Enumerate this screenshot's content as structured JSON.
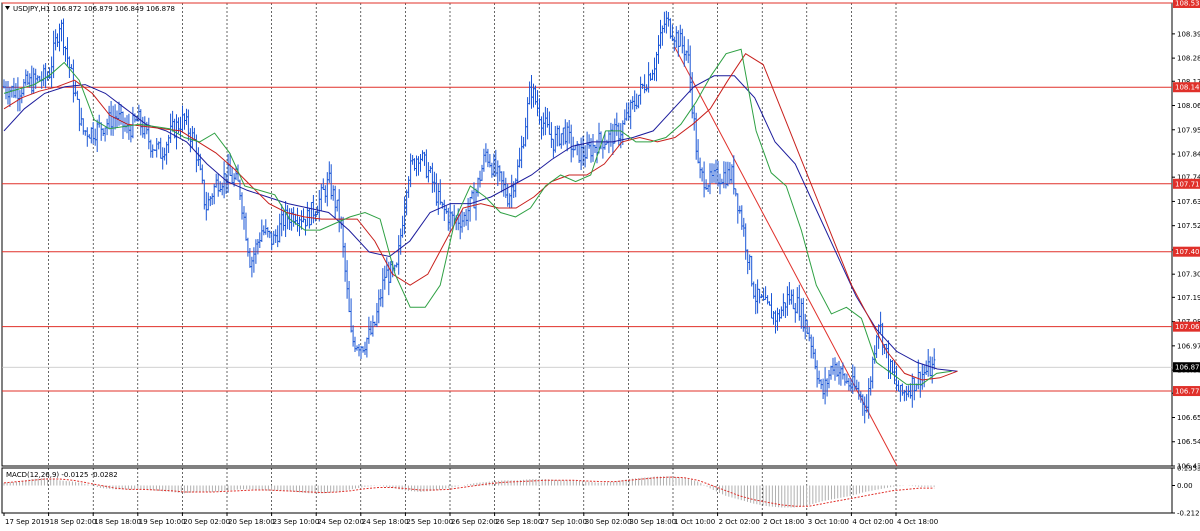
{
  "window": {
    "symbol_header": "USDJPY,H1  106.872 106.879 106.849 106.878",
    "macd_header": "MACD(12,26,9) -0.0125 -0.0282"
  },
  "colors": {
    "candle": "#1a56d6",
    "level": "#e0302a",
    "ma_fast": "#2ea043",
    "ma_mid": "#c8201c",
    "ma_slow": "#1c1c9c",
    "price_tag": "#000000",
    "macd_hist": "#b0b0b0",
    "macd_signal": "#e0302a"
  },
  "chart_data": {
    "type": "candlestick",
    "symbol": "USDJPY",
    "timeframe": "H1",
    "ylim": [
      106.43,
      108.53
    ],
    "y_ticks": [
      "108.390",
      "108.280",
      "108.175",
      "108.065",
      "107.955",
      "107.845",
      "107.740",
      "107.630",
      "107.520",
      "107.410",
      "107.300",
      "107.195",
      "107.085",
      "106.975",
      "106.865",
      "106.760",
      "106.650",
      "106.540",
      "106.430"
    ],
    "x_ticks": [
      "17 Sep 2019",
      "18 Sep 02:00",
      "18 Sep 18:00",
      "19 Sep 10:00",
      "20 Sep 02:00",
      "20 Sep 18:00",
      "23 Sep 10:00",
      "24 Sep 02:00",
      "24 Sep 18:00",
      "25 Sep 10:00",
      "26 Sep 02:00",
      "26 Sep 18:00",
      "27 Sep 10:00",
      "30 Sep 02:00",
      "30 Sep 18:00",
      "1 Oct 10:00",
      "2 Oct 02:00",
      "2 Oct 18:00",
      "3 Oct 10:00",
      "4 Oct 02:00",
      "4 Oct 18:00"
    ],
    "levels": [
      {
        "value": 108.53,
        "label": "108.530"
      },
      {
        "value": 108.148,
        "label": "108.148"
      },
      {
        "value": 107.71,
        "label": "107.710"
      },
      {
        "value": 107.402,
        "label": "107.402"
      },
      {
        "value": 107.062,
        "label": "107.062"
      },
      {
        "value": 106.77,
        "label": "106.770"
      }
    ],
    "current_price": {
      "value": 106.878,
      "label": "106.878"
    },
    "price_path": [
      108.15,
      108.13,
      108.16,
      108.18,
      108.2,
      108.45,
      108.2,
      107.95,
      107.95,
      107.98,
      108.02,
      107.95,
      108.0,
      107.9,
      107.85,
      107.95,
      108.0,
      107.9,
      107.6,
      107.72,
      107.75,
      107.7,
      107.35,
      107.5,
      107.45,
      107.55,
      107.58,
      107.55,
      107.62,
      107.72,
      107.55,
      107.0,
      106.98,
      107.05,
      107.3,
      107.3,
      107.75,
      107.85,
      107.75,
      107.6,
      107.55,
      107.55,
      107.65,
      107.85,
      107.75,
      107.65,
      107.8,
      108.15,
      108.0,
      107.9,
      107.95,
      107.85,
      107.85,
      107.9,
      107.92,
      107.95,
      108.05,
      108.15,
      108.25,
      108.45,
      108.38,
      108.3,
      107.75,
      107.72,
      107.75,
      107.75,
      107.5,
      107.2,
      107.15,
      107.1,
      107.2,
      107.15,
      107.0,
      106.75,
      106.9,
      106.82,
      106.78,
      106.7,
      107.1,
      106.88,
      106.75,
      106.8,
      106.85,
      106.878
    ],
    "ma_fast": [
      108.12,
      108.14,
      108.16,
      108.2,
      108.26,
      108.18,
      108.0,
      107.96,
      107.97,
      107.98,
      107.97,
      107.96,
      107.92,
      107.9,
      107.94,
      107.85,
      107.7,
      107.68,
      107.66,
      107.55,
      107.5,
      107.5,
      107.53,
      107.56,
      107.58,
      107.55,
      107.3,
      107.15,
      107.15,
      107.25,
      107.55,
      107.7,
      107.65,
      107.58,
      107.56,
      107.6,
      107.7,
      107.75,
      107.72,
      107.75,
      107.95,
      107.95,
      107.9,
      107.9,
      107.92,
      107.98,
      108.08,
      108.2,
      108.3,
      108.32,
      107.95,
      107.76,
      107.7,
      107.5,
      107.25,
      107.12,
      107.15,
      107.1,
      106.9,
      106.85,
      106.8,
      106.8,
      106.85,
      106.86
    ],
    "ma_mid": [
      108.05,
      108.1,
      108.13,
      108.15,
      108.18,
      108.12,
      108.02,
      107.98,
      107.97,
      107.96,
      107.95,
      107.9,
      107.85,
      107.78,
      107.7,
      107.62,
      107.58,
      107.56,
      107.55,
      107.55,
      107.55,
      107.45,
      107.3,
      107.25,
      107.3,
      107.45,
      107.6,
      107.62,
      107.6,
      107.6,
      107.65,
      107.72,
      107.75,
      107.75,
      107.8,
      107.9,
      107.92,
      107.9,
      107.92,
      107.98,
      108.05,
      108.18,
      108.3,
      108.25,
      108.05,
      107.85,
      107.65,
      107.45,
      107.25,
      107.1,
      106.95,
      106.85,
      106.82,
      106.83,
      106.86
    ],
    "ma_slow": [
      107.95,
      108.05,
      108.12,
      108.15,
      108.16,
      108.12,
      108.05,
      107.98,
      107.95,
      107.9,
      107.8,
      107.72,
      107.68,
      107.65,
      107.62,
      107.6,
      107.58,
      107.5,
      107.4,
      107.38,
      107.45,
      107.58,
      107.62,
      107.62,
      107.65,
      107.7,
      107.75,
      107.82,
      107.88,
      107.9,
      107.9,
      107.92,
      107.95,
      108.05,
      108.15,
      108.2,
      108.2,
      108.1,
      107.9,
      107.8,
      107.6,
      107.4,
      107.2,
      107.05,
      106.95,
      106.9,
      106.87,
      106.86
    ],
    "trendline": {
      "from": [
        108.33,
        0.575
      ],
      "to": [
        106.43,
        0.765
      ]
    },
    "macd": {
      "label": "MACD(12,26,9)",
      "y_ticks": [
        "0.1353",
        "0.00",
        "-0.2124"
      ],
      "hist": [
        0.02,
        0.03,
        0.05,
        0.06,
        0.04,
        0.03,
        0.01,
        -0.02,
        -0.03,
        -0.03,
        -0.03,
        -0.04,
        -0.05,
        -0.06,
        -0.05,
        -0.05,
        -0.04,
        -0.03,
        -0.03,
        -0.04,
        -0.04,
        -0.05,
        -0.06,
        -0.06,
        -0.05,
        -0.03,
        -0.01,
        0.0,
        -0.02,
        -0.04,
        -0.05,
        -0.04,
        -0.02,
        0.0,
        0.02,
        0.03,
        0.04,
        0.04,
        0.05,
        0.05,
        0.04,
        0.04,
        0.03,
        0.02,
        0.03,
        0.05,
        0.06,
        0.07,
        0.07,
        0.06,
        0.03,
        -0.03,
        -0.08,
        -0.11,
        -0.14,
        -0.16,
        -0.17,
        -0.17,
        -0.15,
        -0.12,
        -0.1,
        -0.08,
        -0.05,
        -0.03,
        -0.01,
        0.0,
        -0.01,
        -0.01
      ],
      "signal": [
        0.02,
        0.03,
        0.04,
        0.05,
        0.05,
        0.04,
        0.02,
        0.0,
        -0.02,
        -0.03,
        -0.03,
        -0.035,
        -0.04,
        -0.05,
        -0.05,
        -0.05,
        -0.045,
        -0.04,
        -0.035,
        -0.035,
        -0.04,
        -0.045,
        -0.05,
        -0.055,
        -0.05,
        -0.04,
        -0.025,
        -0.015,
        -0.015,
        -0.025,
        -0.035,
        -0.035,
        -0.03,
        -0.015,
        0.0,
        0.015,
        0.025,
        0.03,
        0.035,
        0.04,
        0.04,
        0.04,
        0.035,
        0.03,
        0.03,
        0.04,
        0.05,
        0.06,
        0.065,
        0.06,
        0.04,
        0.0,
        -0.04,
        -0.08,
        -0.11,
        -0.13,
        -0.15,
        -0.16,
        -0.16,
        -0.14,
        -0.12,
        -0.1,
        -0.08,
        -0.06,
        -0.04,
        -0.03,
        -0.02,
        -0.02
      ]
    }
  }
}
